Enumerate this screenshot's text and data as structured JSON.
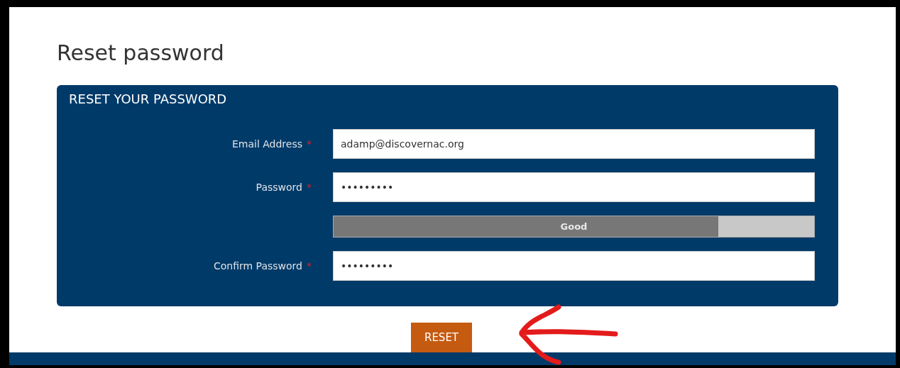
{
  "page": {
    "title": "Reset password"
  },
  "panel": {
    "title": "RESET YOUR PASSWORD",
    "rows": [
      {
        "kind": "field",
        "label": "Email Address",
        "required_mark": "*",
        "value": "adamp@discovernac.org"
      },
      {
        "kind": "field",
        "label": "Password",
        "required_mark": "*",
        "value": "•••••••••"
      },
      {
        "kind": "meter",
        "label_text": "Good",
        "level": 0.8
      },
      {
        "kind": "field",
        "label": "Confirm Password",
        "required_mark": "*",
        "value": "•••••••••"
      }
    ]
  },
  "button": {
    "label": "RESET"
  }
}
